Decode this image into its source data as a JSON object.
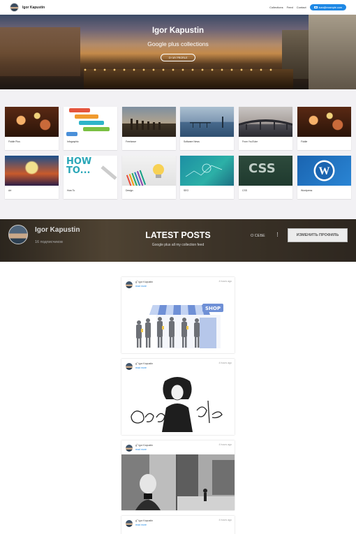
{
  "nav": {
    "brand": "Igor Kapustin",
    "links": [
      "Collections",
      "Feed",
      "Contact"
    ],
    "email": "ivan@example.com"
  },
  "hero": {
    "title": "Igor Kapustin",
    "subtitle": "Google plus collections",
    "button": "G+ MY PROFILE"
  },
  "collections": [
    {
      "label": "Fiddle Plus",
      "thumb": "bokeh-lights"
    },
    {
      "label": "Infographic",
      "thumb": "infographic-steps"
    },
    {
      "label": "Freelance",
      "thumb": "pier-posts"
    },
    {
      "label": "Software News",
      "thumb": "sea-pier"
    },
    {
      "label": "From YouTube",
      "thumb": "bridge"
    },
    {
      "label": "Fiddle",
      "thumb": "bokeh-lights"
    },
    {
      "label": "Art",
      "thumb": "painting-rain"
    },
    {
      "label": "How To",
      "thumb": "how-to-text"
    },
    {
      "label": "Design",
      "thumb": "pencils-bulb"
    },
    {
      "label": "SEO",
      "thumb": "seo-drawing"
    },
    {
      "label": "CSS",
      "thumb": "css-chalkboard"
    },
    {
      "label": "Wordpress",
      "thumb": "wordpress-logo"
    }
  ],
  "profilebar": {
    "name": "Igor Kapustin",
    "subscribers": "16 подписчиков",
    "heading": "LATEST POSTS",
    "subheading": "Google plus all my collection feed",
    "about": "О СЕБЕ",
    "edit_button": "ИЗМЕНИТЬ ПРОФИЛЬ"
  },
  "posts": [
    {
      "author": "Igor Kapustin",
      "read": "read more",
      "time": "4 hours ago",
      "image": "shop-queue-illustration"
    },
    {
      "author": "Igor Kapustin",
      "read": "read more",
      "time": "4 hours ago",
      "image": "google-doodle-woman"
    },
    {
      "author": "Igor Kapustin",
      "read": "read more",
      "time": "4 hours ago",
      "image": "street-photographer"
    },
    {
      "author": "Igor Kapustin",
      "read": "read more",
      "time": "4 hours ago",
      "image": "post-image"
    }
  ],
  "colors": {
    "accent": "#1e88e5",
    "collections_bg": "#f2f1f4"
  }
}
